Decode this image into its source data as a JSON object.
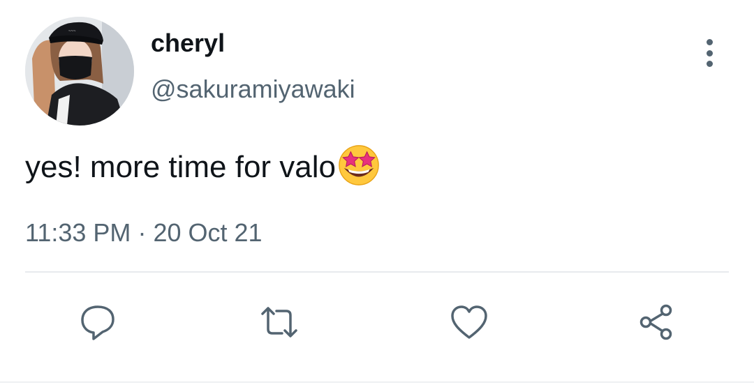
{
  "tweet": {
    "display_name": "cheryl",
    "handle": "@sakuramiyawaki",
    "text": "yes! more time for valo",
    "emoji": "star-struck-emoji",
    "time": "11:33 PM",
    "separator": "·",
    "date": "20 Oct 21"
  },
  "icons": {
    "more": "more-vertical-icon",
    "reply": "reply-icon",
    "retweet": "retweet-icon",
    "like": "heart-icon",
    "share": "share-icon"
  },
  "colors": {
    "text": "#0f1419",
    "secondary": "#536471",
    "divider": "#e7eaed"
  }
}
